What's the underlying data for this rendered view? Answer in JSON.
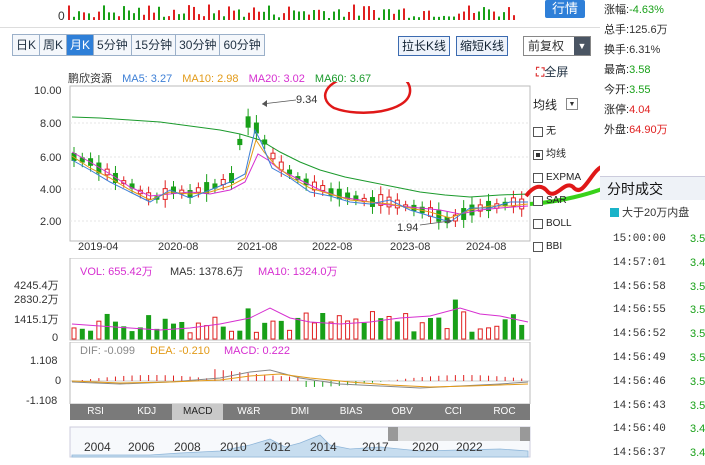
{
  "top": {
    "zero_label": "0",
    "quote_button": "行情"
  },
  "tabs": [
    {
      "label": "日K",
      "active": false
    },
    {
      "label": "周K",
      "active": false
    },
    {
      "label": "月K",
      "active": true
    },
    {
      "label": "5分钟",
      "active": false
    },
    {
      "label": "15分钟",
      "active": false
    },
    {
      "label": "30分钟",
      "active": false
    },
    {
      "label": "60分钟",
      "active": false
    }
  ],
  "toolbar": {
    "stretch": "拉长K线",
    "shrink": "缩短K线",
    "adjust": "前复权"
  },
  "stock": {
    "name": "鹏欣资源"
  },
  "ma": {
    "ma5": "MA5: 3.27",
    "ma10": "MA10: 2.98",
    "ma20": "MA20: 3.02",
    "ma60": "MA60: 3.67"
  },
  "fullscreen": "全屏",
  "price_axis": [
    "10.00",
    "8.00",
    "6.00",
    "4.00",
    "2.00"
  ],
  "time_axis": [
    "2019-04",
    "2020-08",
    "2021-08",
    "2022-08",
    "2023-08",
    "2024-08"
  ],
  "annotations": {
    "high": "9.34",
    "low": "1.94"
  },
  "indicator_panel": {
    "select": "均线",
    "items": [
      {
        "label": "无",
        "checked": false
      },
      {
        "label": "均线",
        "checked": true
      },
      {
        "label": "EXPMA",
        "checked": false
      },
      {
        "label": "SAR",
        "checked": false
      },
      {
        "label": "BOLL",
        "checked": false
      },
      {
        "label": "BBI",
        "checked": false
      }
    ]
  },
  "volume": {
    "vol": "VOL: 655.42万",
    "ma5": "MA5: 1378.6万",
    "ma10": "MA10: 1324.0万",
    "axis": [
      "4245.4万",
      "2830.2万",
      "1415.1万",
      "0"
    ]
  },
  "macd": {
    "dif": "DIF: -0.099",
    "dea": "DEA: -0.210",
    "macd": "MACD: 0.222",
    "axis": [
      "1.108",
      "0",
      "-1.108"
    ]
  },
  "indicator_tabs": [
    {
      "label": "RSI",
      "active": false
    },
    {
      "label": "KDJ",
      "active": false
    },
    {
      "label": "MACD",
      "active": true
    },
    {
      "label": "W&R",
      "active": false
    },
    {
      "label": "DMI",
      "active": false
    },
    {
      "label": "BIAS",
      "active": false
    },
    {
      "label": "OBV",
      "active": false
    },
    {
      "label": "CCI",
      "active": false
    },
    {
      "label": "ROC",
      "active": false
    }
  ],
  "timeline_years": [
    "2004",
    "2006",
    "2008",
    "2010",
    "2012",
    "2014",
    "2017",
    "2020",
    "2022"
  ],
  "quote": [
    {
      "label": "涨幅:",
      "value": "-4.63%",
      "cls": "down"
    },
    {
      "label": "总手:",
      "value": "125.6万",
      "cls": ""
    },
    {
      "label": "换手:",
      "value": "6.31%",
      "cls": ""
    },
    {
      "label": "最高:",
      "value": "3.58",
      "cls": "down"
    },
    {
      "label": "今开:",
      "value": "3.55",
      "cls": "down"
    },
    {
      "label": "涨停:",
      "value": "4.04",
      "cls": "up"
    },
    {
      "label": "外盘:",
      "value": "64.90万",
      "cls": "up"
    }
  ],
  "ticks_title": "分时成交",
  "ticks_filter": "大于20万内盘",
  "ticks": [
    {
      "time": "15:00:00",
      "price": "3.5"
    },
    {
      "time": "14:57:01",
      "price": "3.4"
    },
    {
      "time": "14:56:58",
      "price": "3.5"
    },
    {
      "time": "14:56:55",
      "price": "3.5"
    },
    {
      "time": "14:56:52",
      "price": "3.5"
    },
    {
      "time": "14:56:49",
      "price": "3.5"
    },
    {
      "time": "14:56:46",
      "price": "3.5"
    },
    {
      "time": "14:56:43",
      "price": "3.5"
    },
    {
      "time": "14:56:40",
      "price": "3.4"
    },
    {
      "time": "14:56:37",
      "price": "3.4"
    }
  ],
  "colors": {
    "ma5": "#3d7fd6",
    "ma10": "#e29a18",
    "ma20": "#d62fd0",
    "ma60": "#1b9a2c",
    "up": "#e02020",
    "down": "#18a018"
  }
}
